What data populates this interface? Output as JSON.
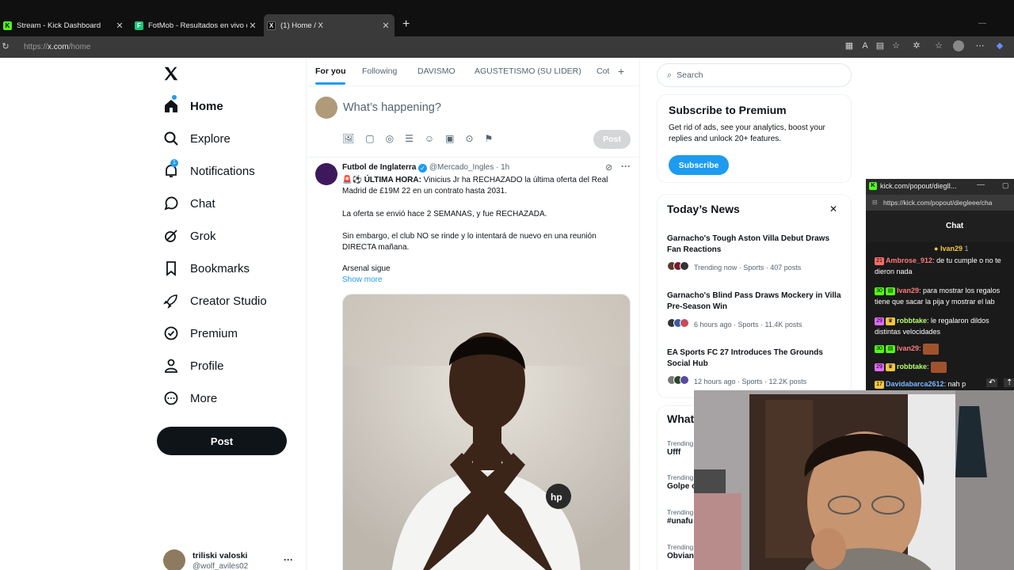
{
  "browser": {
    "tabs": [
      {
        "title": "Stream - Kick Dashboard",
        "icon": "kick-icon"
      },
      {
        "title": "FotMob - Resultados en vivo de fú",
        "icon": "fotmob-icon"
      },
      {
        "title": "(1) Home / X",
        "icon": "x-logo-icon"
      }
    ],
    "url_prefix": "https://",
    "url_host": "x.com",
    "url_path": "/home"
  },
  "sidebar": {
    "items": [
      {
        "label": "Home",
        "icon": "home-icon"
      },
      {
        "label": "Explore",
        "icon": "search-icon"
      },
      {
        "label": "Notifications",
        "icon": "bell-icon"
      },
      {
        "label": "Chat",
        "icon": "chat-icon"
      },
      {
        "label": "Grok",
        "icon": "grok-icon"
      },
      {
        "label": "Bookmarks",
        "icon": "bookmark-icon"
      },
      {
        "label": "Creator Studio",
        "icon": "rocket-icon"
      },
      {
        "label": "Premium",
        "icon": "premium-icon"
      },
      {
        "label": "Profile",
        "icon": "person-icon"
      },
      {
        "label": "More",
        "icon": "more-circle-icon"
      }
    ],
    "post_label": "Post",
    "account_name": "triliski valoski",
    "account_handle": "@wolf_aviles02"
  },
  "feed": {
    "tabs": [
      "For you",
      "Following",
      "DAVISMO",
      "AGUSTETISMO (SU LIDER)",
      "Cot"
    ],
    "compose_placeholder": "What’s happening?",
    "compose_post_label": "Post",
    "tweet": {
      "author": "Futbol de Inglaterra",
      "handle": "@Mercado_Ingles",
      "time": "· 1h",
      "line1_prefix": "🚨⚽",
      "line1_bold": "ÚLTIMA HORA:",
      "line1_rest": " Vinicius Jr ha RECHAZADO la última oferta del Real Madrid de £19M 22 en un contrato hasta 2031.",
      "line2": "La oferta se envió hace 2 SEMANAS, y fue RECHAZADA.",
      "line3": "Sin embargo, el club NO se rinde y lo intentará de nuevo en una reunión DIRECTA mañana.",
      "line4": "Arsenal sigue",
      "show_more": "Show more"
    }
  },
  "right": {
    "search_placeholder": "Search",
    "premium": {
      "title": "Subscribe to Premium",
      "body": "Get rid of ads, see your analytics, boost your replies and unlock 20+ features.",
      "button": "Subscribe"
    },
    "news": {
      "title": "Today’s News",
      "items": [
        {
          "title": "Garnacho's Tough Aston Villa Debut Draws Fan Reactions",
          "meta": "Trending now · Sports · 407 posts"
        },
        {
          "title": "Garnacho's Blind Pass Draws Mockery in Villa Pre-Season Win",
          "meta": "6 hours ago · Sports · 11.4K posts"
        },
        {
          "title": "EA Sports FC 27 Introduces The Grounds Social Hub",
          "meta": "12 hours ago · Sports · 12.2K posts"
        }
      ]
    },
    "whats_happening": {
      "title": "What",
      "items": [
        {
          "label": "Trending",
          "name": "Ufff"
        },
        {
          "label": "Trending",
          "name": "Golpe c"
        },
        {
          "label": "Trending",
          "name": "#unafu"
        },
        {
          "label": "Trending",
          "name": "Obvian"
        }
      ]
    }
  },
  "kick_popout": {
    "title": "kick.com/popout/dieglI...",
    "url": "https://kick.com/popout/diegleee/cha",
    "header": "Chat",
    "pinned_user": "Ivan29",
    "pinned_count": "1",
    "messages": [
      {
        "user": "Ambrose_912",
        "text": "de tu cumple o no te dieron nada",
        "color": "#ff7a7a"
      },
      {
        "user": "Ivan29",
        "text": "para mostrar los regalos tiene que sacar la pija y mostrar el lab",
        "color": "#ff7a7a",
        "badge": "30"
      },
      {
        "user": "robbtake",
        "text": "le regalaron dildos distintas velocidades",
        "color": "#b8ff6b",
        "badge": "29"
      },
      {
        "user": "Ivan29",
        "text": "",
        "color": "#ff7a7a",
        "badge": "30"
      },
      {
        "user": "robbtake",
        "text": "",
        "color": "#b8ff6b",
        "badge": "29"
      },
      {
        "user": "Davidabarca2612",
        "text": "nah p",
        "color": "#7ab8ff",
        "badge": "17"
      }
    ]
  },
  "colors": {
    "x_blue": "#1d9bf0",
    "text": "#0f1419",
    "muted": "#536471",
    "kick_green": "#53fc18"
  }
}
